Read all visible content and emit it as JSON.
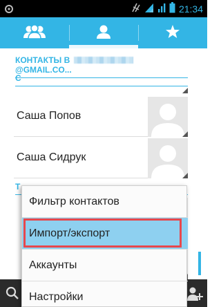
{
  "status_bar": {
    "time": "21:34",
    "icons": [
      "usb-debug-icon",
      "no-signal-icon",
      "wifi-icon",
      "signal-icon",
      "battery-icon"
    ]
  },
  "tabs": [
    {
      "icon": "groups-icon",
      "active": false
    },
    {
      "icon": "contact-person-icon",
      "active": true
    },
    {
      "icon": "favorites-star-icon",
      "active": false
    }
  ],
  "header": {
    "account_prefix": "КОНТАКТЫ В",
    "account_suffix": "@GMAIL.CO..."
  },
  "sections": [
    {
      "letter": "С"
    },
    {
      "letter": "Т"
    }
  ],
  "contacts": [
    {
      "name": "Саша Попов"
    },
    {
      "name": "Саша Сидрук"
    }
  ],
  "menu": {
    "items": [
      {
        "label": "Фильтр контактов"
      },
      {
        "label": "Импорт/экспорт"
      },
      {
        "label": "Аккаунты"
      },
      {
        "label": "Настройки"
      }
    ],
    "highlighted_index": 1
  },
  "colors": {
    "accent": "#33b5e5",
    "highlight": "#8ed0f0",
    "annotation": "#e8474c",
    "status_bar": "#000000",
    "bottom_bar": "#2b2b2b"
  }
}
